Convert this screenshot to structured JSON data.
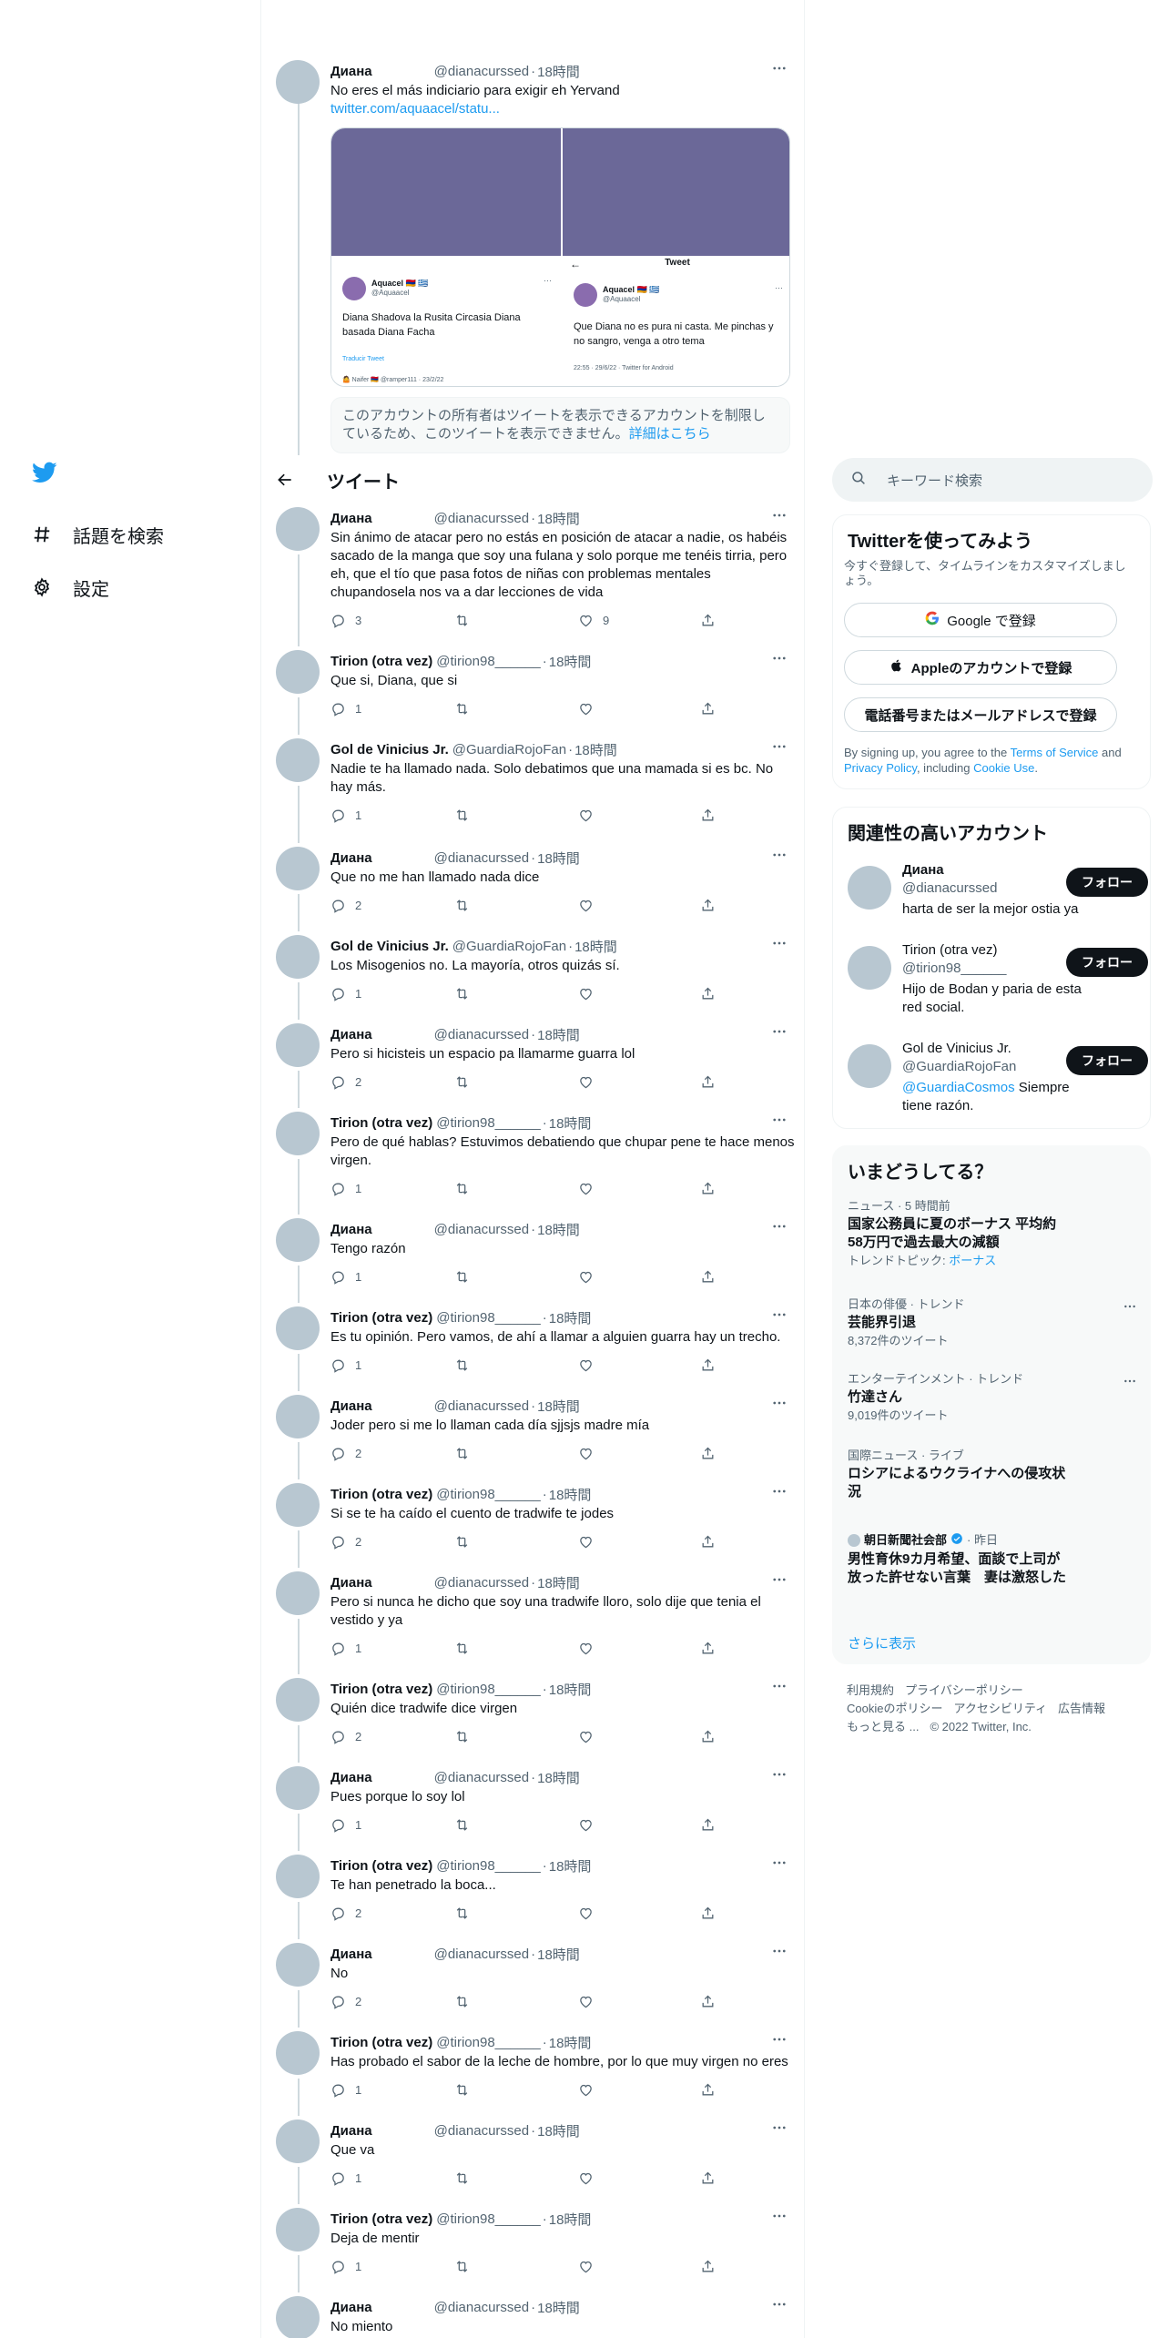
{
  "nav": {
    "items": [
      {
        "label": "話題を検索",
        "icon": "hash-icon"
      },
      {
        "label": "設定",
        "icon": "gear-icon"
      }
    ]
  },
  "header": {
    "title": "ツイート"
  },
  "quoted_tweet": {
    "name": "Диана",
    "handle": "@dianacurssed",
    "time": "18時間",
    "text": "No eres el más indiciario para exigir eh Yervand",
    "link": "twitter.com/aquaacel/statu...",
    "images": [
      {
        "title": "Tweet",
        "name": "Aquacel 🇦🇲 🇬🇷",
        "handle": "@Aquaacel",
        "text": "Diana Shadova la Rusita Circasia Diana basada Diana Facha",
        "extra": "Traducir Tweet",
        "meta": "🤷 Naifer 🇦🇲 @ramper111 · 23/2/22"
      },
      {
        "title": "Tweet",
        "name": "Aquacel 🇦🇲 🇬🇷",
        "handle": "@Aquaacel",
        "text": "Que Diana no es pura ni casta. Me pinchas y no sangro, venga a otro tema",
        "meta": "22:55 · 29/6/22 · Twitter for Android"
      }
    ],
    "notice": "このアカウントの所有者はツイートを表示できるアカウントを制限しているため、このツイートを表示できません。",
    "notice_link": "詳細はこちら"
  },
  "tweets": [
    {
      "name": "Диана",
      "handle": "@dianacurssed",
      "time": "18時間",
      "text": "Sin ánimo de atacar pero no estás en posición de atacar a nadie, os habéis sacado de la manga que soy una fulana y solo porque me tenéis tirria, pero eh, que el tío que pasa fotos de niñas con problemas mentales chupandosela nos va a dar lecciones de vida",
      "replies": "3",
      "retweets": "",
      "likes": "9"
    },
    {
      "name": "Tirion (otra vez)",
      "handle": "@tirion98______",
      "time": "18時間",
      "text": "Que si, Diana, que si",
      "replies": "1",
      "retweets": "",
      "likes": ""
    },
    {
      "name": "Gol de Vinicius Jr.",
      "handle": "@GuardiaRojoFan",
      "time": "18時間",
      "text": "Nadie te ha llamado nada. Solo debatimos que una mamada si es bc. No hay más.",
      "replies": "1",
      "retweets": "",
      "likes": ""
    },
    {
      "name": "Диана",
      "handle": "@dianacurssed",
      "time": "18時間",
      "text": "Que no me han llamado nada dice",
      "replies": "2",
      "retweets": "",
      "likes": ""
    },
    {
      "name": "Gol de Vinicius Jr.",
      "handle": "@GuardiaRojoFan",
      "time": "18時間",
      "text": "Los Misogenios no. La mayoría, otros quizás sí.",
      "replies": "1",
      "retweets": "",
      "likes": ""
    },
    {
      "name": "Диана",
      "handle": "@dianacurssed",
      "time": "18時間",
      "text": "Pero si hicisteis un espacio pa llamarme guarra lol",
      "replies": "2",
      "retweets": "",
      "likes": ""
    },
    {
      "name": "Tirion (otra vez)",
      "handle": "@tirion98______",
      "time": "18時間",
      "text": "Pero de qué hablas? Estuvimos debatiendo que chupar pene te hace menos virgen.",
      "replies": "1",
      "retweets": "",
      "likes": ""
    },
    {
      "name": "Диана",
      "handle": "@dianacurssed",
      "time": "18時間",
      "text": "Tengo razón",
      "replies": "1",
      "retweets": "",
      "likes": ""
    },
    {
      "name": "Tirion (otra vez)",
      "handle": "@tirion98______",
      "time": "18時間",
      "text": "Es tu opinión. Pero vamos, de ahí a llamar a alguien guarra hay un trecho.",
      "replies": "1",
      "retweets": "",
      "likes": ""
    },
    {
      "name": "Диана",
      "handle": "@dianacurssed",
      "time": "18時間",
      "text": "Joder pero si me lo llaman cada día sjjsjs madre mía",
      "replies": "2",
      "retweets": "",
      "likes": ""
    },
    {
      "name": "Tirion (otra vez)",
      "handle": "@tirion98______",
      "time": "18時間",
      "text": "Si se te ha caído el cuento de tradwife te jodes",
      "replies": "2",
      "retweets": "",
      "likes": ""
    },
    {
      "name": "Диана",
      "handle": "@dianacurssed",
      "time": "18時間",
      "text": "Pero si nunca he dicho que soy una tradwife lloro, solo dije que tenia el vestido y ya",
      "replies": "1",
      "retweets": "",
      "likes": ""
    },
    {
      "name": "Tirion (otra vez)",
      "handle": "@tirion98______",
      "time": "18時間",
      "text": "Quién dice tradwife dice virgen",
      "replies": "2",
      "retweets": "",
      "likes": ""
    },
    {
      "name": "Диана",
      "handle": "@dianacurssed",
      "time": "18時間",
      "text": "Pues porque lo soy lol",
      "replies": "1",
      "retweets": "",
      "likes": ""
    },
    {
      "name": "Tirion (otra vez)",
      "handle": "@tirion98______",
      "time": "18時間",
      "text": "Te han penetrado la boca...",
      "replies": "2",
      "retweets": "",
      "likes": ""
    },
    {
      "name": "Диана",
      "handle": "@dianacurssed",
      "time": "18時間",
      "text": "No",
      "replies": "2",
      "retweets": "",
      "likes": ""
    },
    {
      "name": "Tirion (otra vez)",
      "handle": "@tirion98______",
      "time": "18時間",
      "text": "Has probado el sabor de la leche de hombre, por lo que muy virgen no eres",
      "replies": "1",
      "retweets": "",
      "likes": ""
    },
    {
      "name": "Диана",
      "handle": "@dianacurssed",
      "time": "18時間",
      "text": "Que va",
      "replies": "1",
      "retweets": "",
      "likes": ""
    },
    {
      "name": "Tirion (otra vez)",
      "handle": "@tirion98______",
      "time": "18時間",
      "text": "Deja de mentir",
      "replies": "1",
      "retweets": "",
      "likes": ""
    },
    {
      "name": "Диана",
      "handle": "@dianacurssed",
      "time": "18時間",
      "text": "No miento",
      "replies": "",
      "retweets": "",
      "likes": ""
    }
  ],
  "search": {
    "placeholder": "キーワード検索"
  },
  "signup": {
    "title": "Twitterを使ってみよう",
    "subtitle": "今すぐ登録して、タイムラインをカスタマイズしましょう。",
    "google": "Google で登録",
    "apple": "Appleのアカウントで登録",
    "phone": "電話番号またはメールアドレスで登録",
    "terms_prefix": "By signing up, you agree to the ",
    "terms_link": "Terms of Service",
    "terms_and": " and ",
    "privacy_link": "Privacy Policy",
    "terms_including": ", including ",
    "cookie_link": "Cookie Use",
    "terms_end": "."
  },
  "relevant": {
    "title": "関連性の高いアカウント",
    "follow_label": "フォロー",
    "accounts": [
      {
        "name": "Диана",
        "handle": "@dianacurssed",
        "bio": "harta de ser la mejor ostia ya"
      },
      {
        "name": "Tirion (otra vez)",
        "handle": "@tirion98______",
        "bio": "Hijo de Bodan y paria de esta red social."
      },
      {
        "name": "Gol de Vinicius Jr.",
        "handle": "@GuardiaRojoFan",
        "bio_link": "@GuardiaCosmos",
        "bio": " Siempre tiene razón."
      }
    ]
  },
  "trends": {
    "title": "いまどうしてる？",
    "items": [
      {
        "meta": "ニュース · 5 時間前",
        "title": "国家公務員に夏のボーナス 平均約58万円で過去最大の減額",
        "count_prefix": "トレンドトピック: ",
        "count_link": "ボーナス"
      },
      {
        "meta": "日本の俳優 · トレンド",
        "title": "芸能界引退",
        "count": "8,372件のツイート"
      },
      {
        "meta": "エンターテインメント · トレンド",
        "title": "竹達さん",
        "count": "9,019件のツイート"
      },
      {
        "meta": "国際ニュース · ライブ",
        "title": "ロシアによるウクライナへの侵攻状況"
      },
      {
        "meta_name": "朝日新聞社会部",
        "meta_time": " · 昨日",
        "title": "男性育休9カ月希望、面談で上司が放った許せない言葉　妻は激怒した"
      }
    ],
    "show_more": "さらに表示"
  },
  "footer": {
    "links": [
      "利用規約",
      "プライバシーポリシー",
      "Cookieのポリシー",
      "アクセシビリティ",
      "広告情報",
      "もっと見る ..."
    ],
    "copyright": "© 2022 Twitter, Inc."
  },
  "colors": {
    "accent": "#1d9bf0",
    "text": "#0f1419",
    "muted": "#536471",
    "follow_bg": "#0f1419"
  }
}
